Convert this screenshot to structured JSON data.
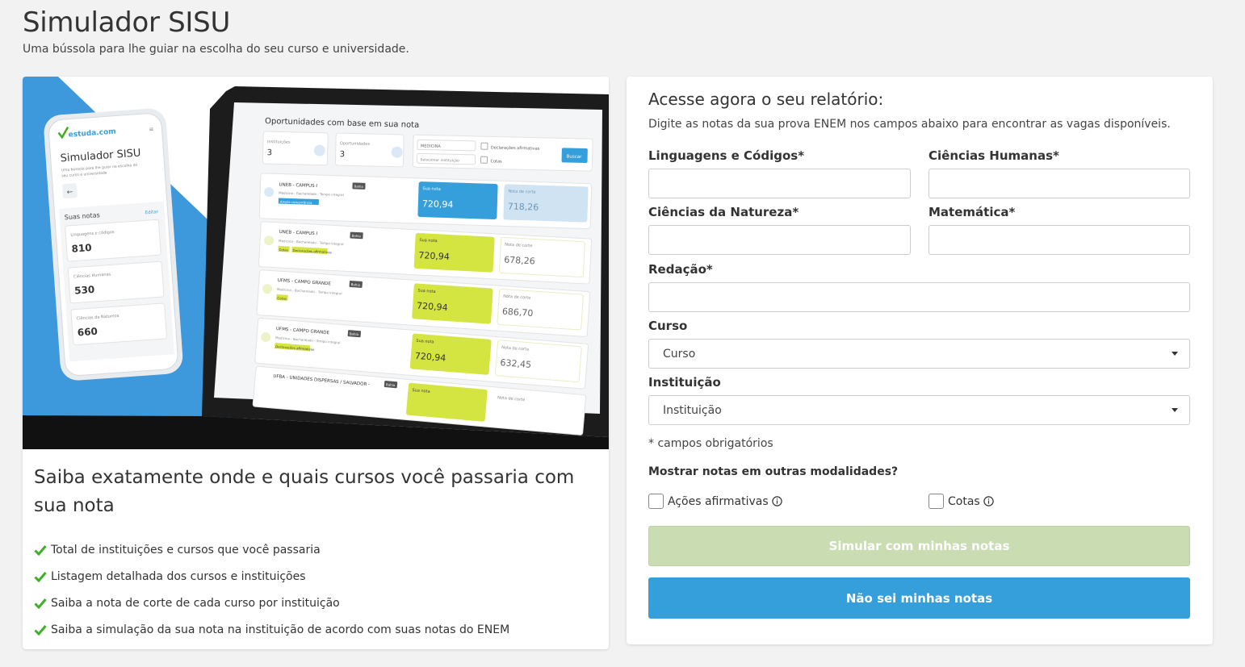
{
  "header": {
    "title": "Simulador SISU",
    "subtitle": "Uma bússola para lhe guiar na escolha do seu curso e universidade."
  },
  "promo": {
    "mockup": {
      "phone": {
        "logo": "estuda.com",
        "title": "Simulador SISU",
        "subtitle_line1": "Uma bússola para lhe guiar na escolha do",
        "subtitle_line2": "seu curso e universidade",
        "notes_label": "Suas notas",
        "edit_label": "Editar",
        "scores": [
          {
            "label": "Linguagens e códigos",
            "value": "810"
          },
          {
            "label": "Ciências Humanas",
            "value": "530"
          },
          {
            "label": "Ciências da Natureza",
            "value": "660"
          }
        ]
      },
      "laptop": {
        "title": "Oportunidades com base em sua nota",
        "filters": {
          "institutions_label": "Instituições",
          "institutions_value": "3",
          "opportunities_label": "Oportunidades",
          "opportunities_value": "3",
          "course_select": "MEDICINA",
          "institution_select": "Selecionar instituição",
          "declarations_label": "Declarações afirmativas",
          "quotas_label": "Cotas",
          "search_button": "Buscar"
        },
        "your_score_label": "Sua nota",
        "cutoff_label": "Nota de corte",
        "rows": [
          {
            "name": "UNEB - CAMPUS I",
            "state": "Bahia",
            "course": "Medicina - Bacharelado - Tempo integral",
            "tag": "Ampla concorrência",
            "score": "720,94",
            "cutoff": "718,26"
          },
          {
            "name": "UNEB - CAMPUS I",
            "state": "Bahia",
            "course": "Medicina - Bacharelado - Tempo integral",
            "tag": "Cotas",
            "tag2": "Declarações afirmativas",
            "score": "720,94",
            "cutoff": "678,26"
          },
          {
            "name": "UFMS - CAMPO GRANDE",
            "state": "Bahia",
            "course": "Medicina - Bacharelado - Tempo integral",
            "tag": "Cotas",
            "score": "720,94",
            "cutoff": "686,70"
          },
          {
            "name": "UFMS - CAMPO GRANDE",
            "state": "Bahia",
            "course": "Medicina - Bacharelado - Tempo integral",
            "tag": "Declarações afirmativas",
            "score": "720,94",
            "cutoff": "632,45"
          },
          {
            "name": "UFBA - UNIDADES DISPERSAS / SALVADOR -",
            "state": "Bahia",
            "course": "",
            "tag": "",
            "score": "",
            "cutoff": ""
          }
        ]
      }
    },
    "headline": "Saiba exatamente onde e quais cursos você passaria com sua nota",
    "benefits": [
      "Total de instituições e cursos que você passaria",
      "Listagem detalhada dos cursos e instituições",
      "Saiba a nota de corte de cada curso por instituição",
      "Saiba a simulação da sua nota na instituição de acordo com suas notas do ENEM"
    ]
  },
  "form": {
    "title": "Acesse agora o seu relatório:",
    "description": "Digite as notas da sua prova ENEM nos campos abaixo para encontrar as vagas disponíveis.",
    "fields": {
      "linguagens": {
        "label": "Linguagens e Códigos*",
        "value": ""
      },
      "humanas": {
        "label": "Ciências Humanas*",
        "value": ""
      },
      "natureza": {
        "label": "Ciências da Natureza*",
        "value": ""
      },
      "matematica": {
        "label": "Matemática*",
        "value": ""
      },
      "redacao": {
        "label": "Redação*",
        "value": ""
      }
    },
    "curso": {
      "label": "Curso",
      "selected": "Curso"
    },
    "instituicao": {
      "label": "Instituição",
      "selected": "Instituição"
    },
    "required_note": "* campos obrigatórios",
    "modalities_question": "Mostrar notas em outras modalidades?",
    "checkboxes": {
      "acoes": {
        "label": "Ações afirmativas",
        "checked": false
      },
      "cotas": {
        "label": "Cotas",
        "checked": false
      }
    },
    "simulate_button": "Simular com minhas notas",
    "unknown_button": "Não sei minhas notas"
  },
  "colors": {
    "primary_blue": "#359fdc",
    "disabled_green": "#c9dcb2",
    "check_green": "#3fae29",
    "hero_blue": "#3d98dc",
    "score_lime": "#d4e440"
  },
  "icons": [
    "check-icon",
    "info-icon",
    "chevron-down-icon"
  ]
}
